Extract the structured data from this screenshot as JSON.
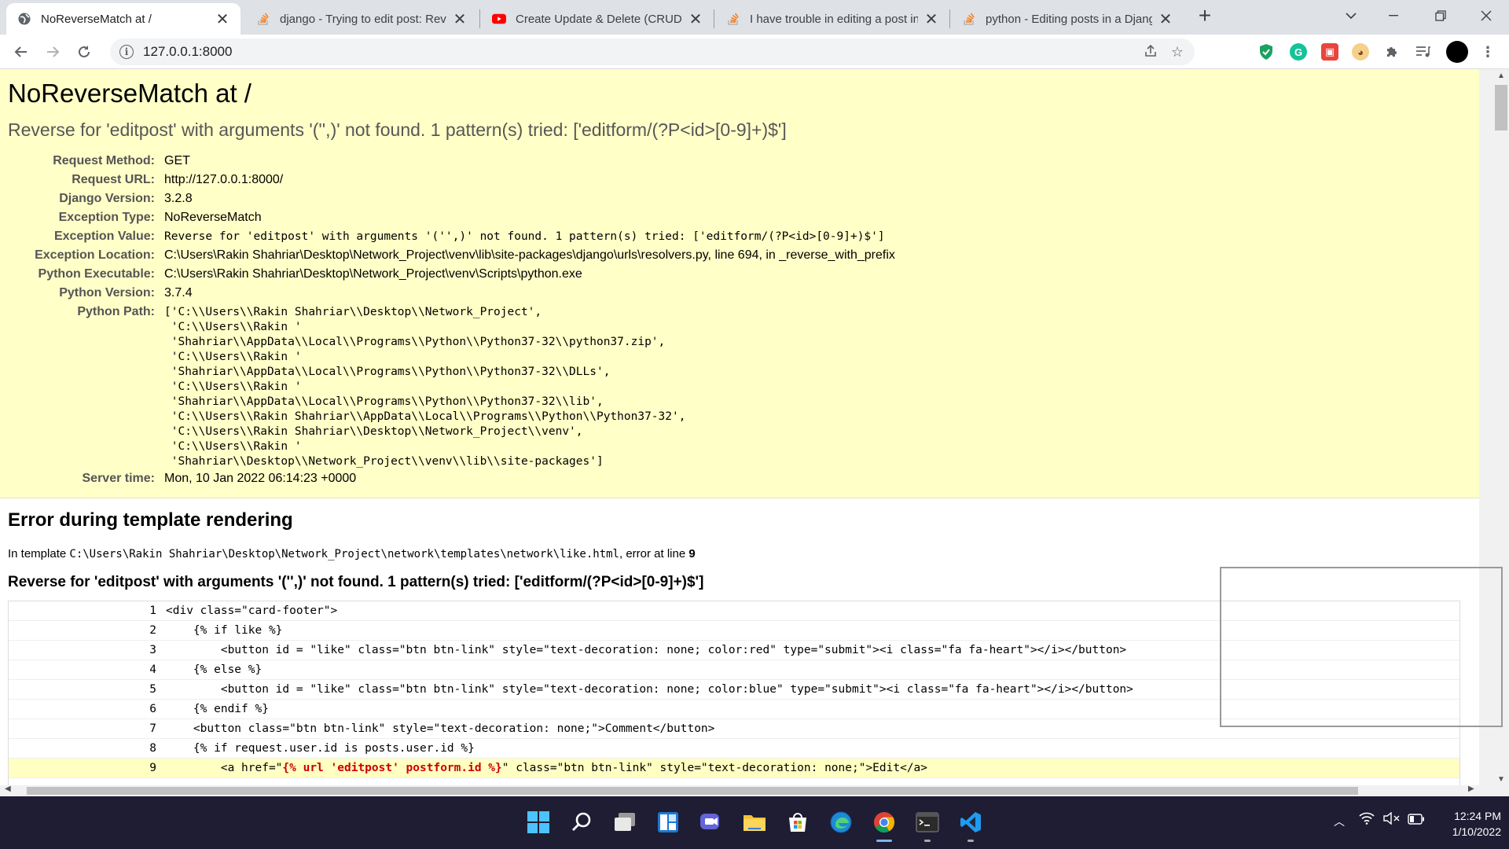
{
  "browser": {
    "tabs": [
      {
        "title": "NoReverseMatch at /",
        "active": true,
        "icon": "globe-icon"
      },
      {
        "title": "django - Trying to edit post: Reve",
        "active": false,
        "icon": "stackoverflow-icon"
      },
      {
        "title": "Create Update & Delete (CRUD) w",
        "active": false,
        "icon": "youtube-icon"
      },
      {
        "title": "I have trouble in editing a post in",
        "active": false,
        "icon": "stackoverflow-icon"
      },
      {
        "title": "python - Editing posts in a Djang",
        "active": false,
        "icon": "stackoverflow-icon"
      }
    ],
    "url": "127.0.0.1:8000"
  },
  "error": {
    "title": "NoReverseMatch at /",
    "subtitle": "Reverse for 'editpost' with arguments '('',)' not found. 1 pattern(s) tried: ['editform/(?P<id>[0-9]+)$']",
    "meta": [
      {
        "key": "Request Method:",
        "value": "GET",
        "style": ""
      },
      {
        "key": "Request URL:",
        "value": "http://127.0.0.1:8000/",
        "style": ""
      },
      {
        "key": "Django Version:",
        "value": "3.2.8",
        "style": ""
      },
      {
        "key": "Exception Type:",
        "value": "NoReverseMatch",
        "style": ""
      },
      {
        "key": "Exception Value:",
        "value": "Reverse for 'editpost' with arguments '('',)' not found. 1 pattern(s) tried: ['editform/(?P<id>[0-9]+)$']",
        "style": "mono"
      },
      {
        "key": "Exception Location:",
        "value": "C:\\Users\\Rakin Shahriar\\Desktop\\Network_Project\\venv\\lib\\site-packages\\django\\urls\\resolvers.py, line 694, in _reverse_with_prefix",
        "style": ""
      },
      {
        "key": "Python Executable:",
        "value": "C:\\Users\\Rakin Shahriar\\Desktop\\Network_Project\\venv\\Scripts\\python.exe",
        "style": ""
      },
      {
        "key": "Python Version:",
        "value": "3.7.4",
        "style": ""
      },
      {
        "key": "Python Path:",
        "value": "['C:\\\\Users\\\\Rakin Shahriar\\\\Desktop\\\\Network_Project',\n 'C:\\\\Users\\\\Rakin '\n 'Shahriar\\\\AppData\\\\Local\\\\Programs\\\\Python\\\\Python37-32\\\\python37.zip',\n 'C:\\\\Users\\\\Rakin '\n 'Shahriar\\\\AppData\\\\Local\\\\Programs\\\\Python\\\\Python37-32\\\\DLLs',\n 'C:\\\\Users\\\\Rakin '\n 'Shahriar\\\\AppData\\\\Local\\\\Programs\\\\Python\\\\Python37-32\\\\lib',\n 'C:\\\\Users\\\\Rakin Shahriar\\\\AppData\\\\Local\\\\Programs\\\\Python\\\\Python37-32',\n 'C:\\\\Users\\\\Rakin Shahriar\\\\Desktop\\\\Network_Project\\\\venv',\n 'C:\\\\Users\\\\Rakin '\n 'Shahriar\\\\Desktop\\\\Network_Project\\\\venv\\\\lib\\\\site-packages']",
        "style": "pre"
      },
      {
        "key": "Server time:",
        "value": "Mon, 10 Jan 2022 06:14:23 +0000",
        "style": ""
      }
    ]
  },
  "template_error": {
    "heading": "Error during template rendering",
    "intro_prefix": "In template",
    "template_path": "C:\\Users\\Rakin Shahriar\\Desktop\\Network_Project\\network\\templates\\network\\like.html",
    "intro_mid": ", error at line",
    "error_line": "9",
    "message": "Reverse for 'editpost' with arguments '('',)' not found. 1 pattern(s) tried: ['editform/(?P<id>[0-9]+)$']",
    "source_lines": [
      {
        "num": "1",
        "code": "<div class=\"card-footer\">"
      },
      {
        "num": "2",
        "code": "    {% if like %}"
      },
      {
        "num": "3",
        "code": "        <button id = \"like\" class=\"btn btn-link\" style=\"text-decoration: none; color:red\" type=\"submit\"><i class=\"fa fa-heart\"></i></button>"
      },
      {
        "num": "4",
        "code": "    {% else %}"
      },
      {
        "num": "5",
        "code": "        <button id = \"like\" class=\"btn btn-link\" style=\"text-decoration: none; color:blue\" type=\"submit\"><i class=\"fa fa-heart\"></i></button>"
      },
      {
        "num": "6",
        "code": "    {% endif %}"
      },
      {
        "num": "7",
        "code": "    <button class=\"btn btn-link\" style=\"text-decoration: none;\">Comment</button>"
      },
      {
        "num": "8",
        "code": "    {% if request.user.id is posts.user.id %}"
      },
      {
        "num": "9",
        "code_pre": "        <a href=\"",
        "code_err": "{% url 'editpost' postform.id %}",
        "code_post": "\" class=\"btn btn-link\" style=\"text-decoration: none;\">Edit</a>",
        "highlight": true
      }
    ]
  },
  "taskbar": {
    "time": "12:24 PM",
    "date": "1/10/2022"
  },
  "colors": {
    "summary_bg": "#ffffc8",
    "highlight_bg": "#ffffc2",
    "error_text": "#cc0000",
    "taskbar_bg": "#1f1d33"
  }
}
